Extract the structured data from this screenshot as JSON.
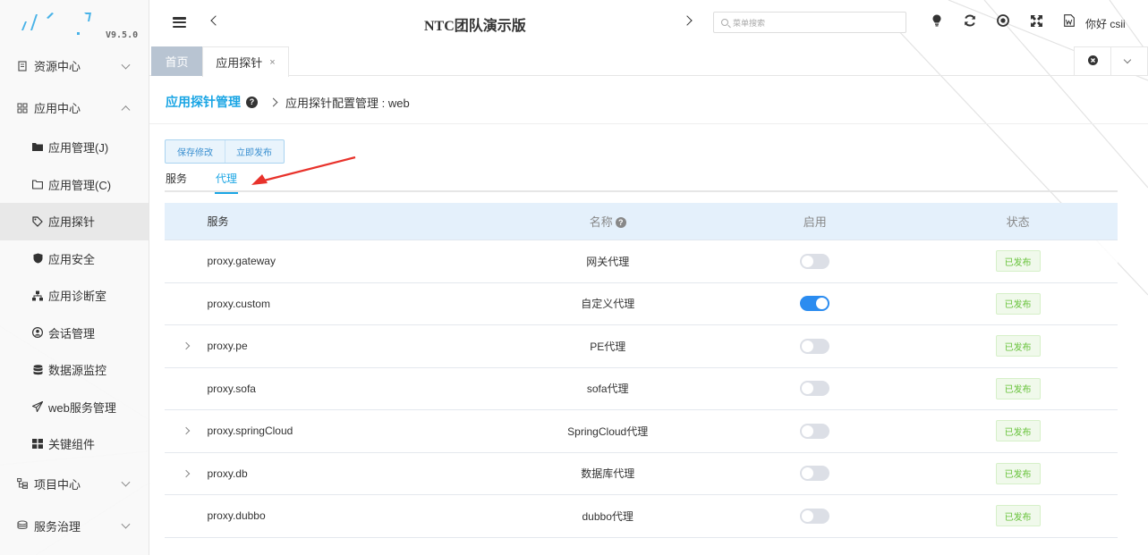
{
  "sidebar": {
    "version": "V9.5.0",
    "groups": [
      {
        "label": "资源中心",
        "icon": "document-icon"
      },
      {
        "label": "应用中心",
        "icon": "grid-icon"
      },
      {
        "label": "项目中心",
        "icon": "folder-tree-icon"
      },
      {
        "label": "服务治理",
        "icon": "server-icon"
      }
    ],
    "items": [
      {
        "label": "应用管理(J)",
        "icon": "folder-filled-icon"
      },
      {
        "label": "应用管理(C)",
        "icon": "folder-outline-icon"
      },
      {
        "label": "应用探针",
        "icon": "tag-icon"
      },
      {
        "label": "应用安全",
        "icon": "shield-icon"
      },
      {
        "label": "应用诊断室",
        "icon": "sitemap-icon"
      },
      {
        "label": "会话管理",
        "icon": "user-circle-icon"
      },
      {
        "label": "数据源监控",
        "icon": "database-icon"
      },
      {
        "label": "web服务管理",
        "icon": "paper-plane-icon"
      },
      {
        "label": "关键组件",
        "icon": "th-large-icon"
      }
    ],
    "active_item": "应用探针"
  },
  "header": {
    "title": "NTC团队演示版",
    "search_placeholder": "菜单搜索",
    "greeting": "你好 csii",
    "icons": [
      "lightbulb-icon",
      "refresh-icon",
      "record-icon",
      "fullscreen-icon",
      "word-doc-icon"
    ]
  },
  "tabs": {
    "home": "首页",
    "active": "应用探针",
    "close_glyph": "×"
  },
  "breadcrumb": {
    "main": "应用探针管理",
    "sub": "应用探针配置管理 : web"
  },
  "toolbar": {
    "save_label": "保存修改",
    "publish_label": "立即发布"
  },
  "subtabs": [
    {
      "label": "服务",
      "active": false
    },
    {
      "label": "代理",
      "active": true
    }
  ],
  "table": {
    "headers": {
      "service": "服务",
      "name": "名称",
      "enabled": "启用",
      "status": "状态"
    },
    "rows": [
      {
        "service": "proxy.gateway",
        "name": "网关代理",
        "enabled": false,
        "status": "已发布",
        "expandable": false
      },
      {
        "service": "proxy.custom",
        "name": "自定义代理",
        "enabled": true,
        "status": "已发布",
        "expandable": false
      },
      {
        "service": "proxy.pe",
        "name": "PE代理",
        "enabled": false,
        "status": "已发布",
        "expandable": true
      },
      {
        "service": "proxy.sofa",
        "name": "sofa代理",
        "enabled": false,
        "status": "已发布",
        "expandable": false
      },
      {
        "service": "proxy.springCloud",
        "name": "SpringCloud代理",
        "enabled": false,
        "status": "已发布",
        "expandable": true
      },
      {
        "service": "proxy.db",
        "name": "数据库代理",
        "enabled": false,
        "status": "已发布",
        "expandable": true
      },
      {
        "service": "proxy.dubbo",
        "name": "dubbo代理",
        "enabled": false,
        "status": "已发布",
        "expandable": false
      }
    ]
  },
  "colors": {
    "accent": "#1aa5e4",
    "switch_on": "#2b8cf0",
    "status_green": "#67c23a",
    "annotation_arrow": "#e8322b"
  }
}
